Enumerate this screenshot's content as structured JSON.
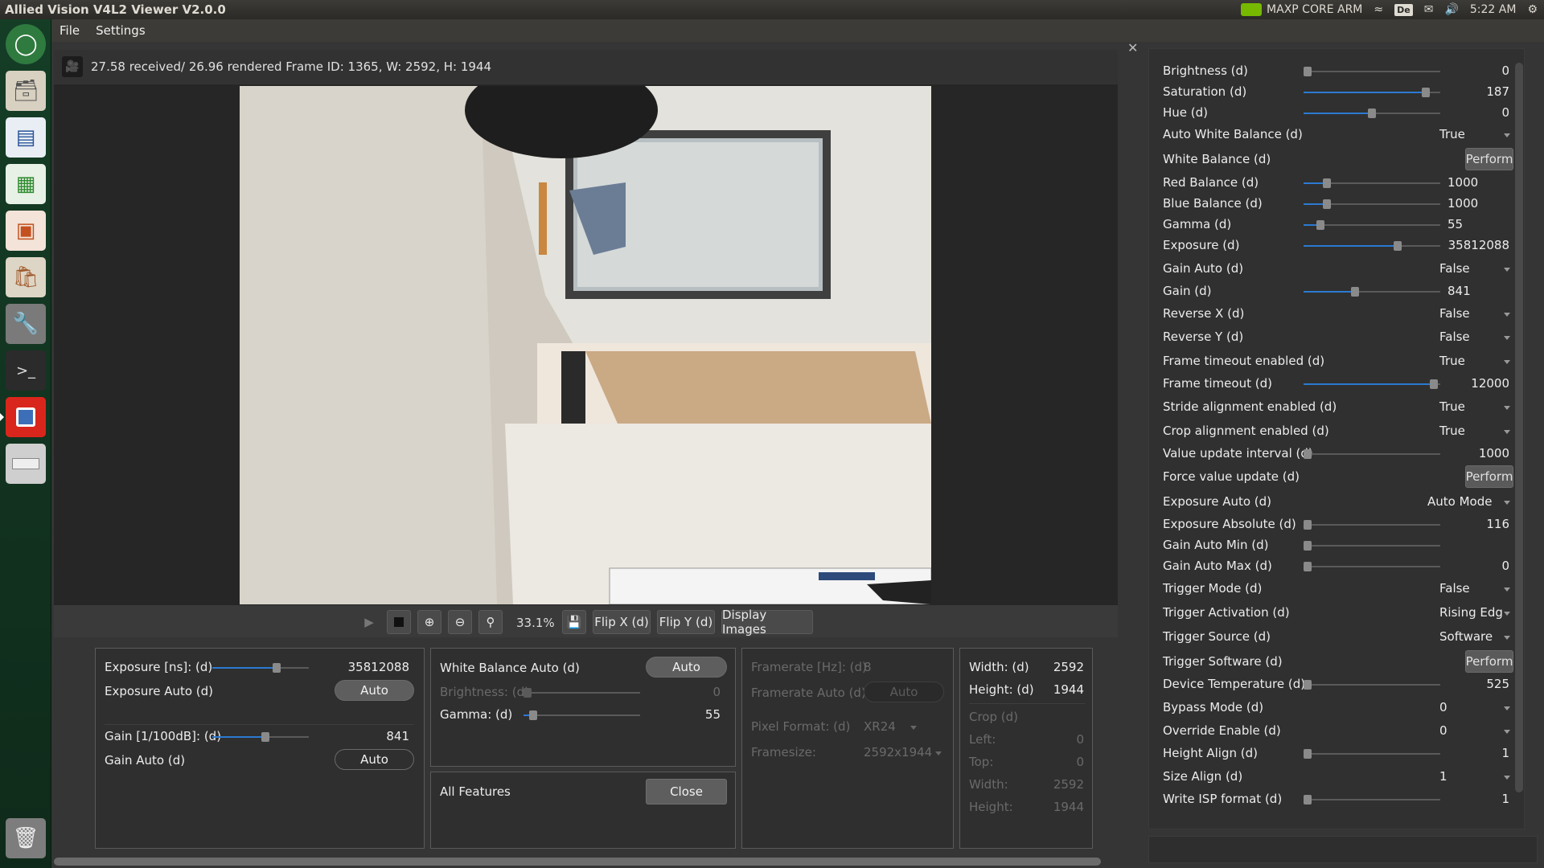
{
  "topbar": {
    "title": "Allied Vision V4L2 Viewer V2.0.0",
    "network_name": "MAXP CORE ARM",
    "keyboard_layout": "De",
    "time": "5:22 AM"
  },
  "menu": {
    "file": "File",
    "settings": "Settings"
  },
  "status": {
    "text": "27.58 received/ 26.96 rendered  Frame ID: 1365, W: 2592, H: 1944"
  },
  "toolbar": {
    "zoom": "33.1%",
    "flip_x": "Flip X (d)",
    "flip_y": "Flip Y (d)",
    "display_images": "Display Images"
  },
  "panel1": {
    "exposure_label": "Exposure [ns]: (d)",
    "exposure_value": "35812088",
    "exposure_level": 0.68,
    "exposure_auto_label": "Exposure Auto (d)",
    "exposure_auto_btn": "Auto",
    "gain_label": "Gain [1/100dB]: (d)",
    "gain_value": "841",
    "gain_level": 0.55,
    "gain_auto_label": "Gain Auto (d)",
    "gain_auto_btn": "Auto"
  },
  "panel2": {
    "wb_auto_label": "White Balance Auto (d)",
    "wb_auto_btn": "Auto",
    "brightness_label": "Brightness: (d)",
    "brightness_value": "0",
    "brightness_level": 0.0,
    "gamma_label": "Gamma: (d)",
    "gamma_value": "55",
    "gamma_level": 0.05,
    "all_features_label": "All Features",
    "close_btn": "Close"
  },
  "panel3": {
    "framerate_label": "Framerate [Hz]: (d)",
    "framerate_value": "8",
    "framerate_auto_label": "Framerate Auto (d)",
    "framerate_auto_btn": "Auto",
    "pixel_format_label": "Pixel Format: (d)",
    "pixel_format_value": "XR24",
    "framesize_label": "Framesize:",
    "framesize_value": "2592x1944"
  },
  "panel4": {
    "width_label": "Width: (d)",
    "width_value": "2592",
    "height_label": "Height: (d)",
    "height_value": "1944",
    "crop_label": "Crop (d)",
    "left_label": "Left:",
    "left_value": "0",
    "top_label": "Top:",
    "top_value": "0",
    "crop_width_label": "Width:",
    "crop_width_value": "2592",
    "crop_height_label": "Height:",
    "crop_height_value": "1944"
  },
  "features": [
    {
      "label": "Brightness (d)",
      "kind": "slider",
      "value": "0",
      "level": 0.0
    },
    {
      "label": "Saturation (d)",
      "kind": "slider",
      "value": "187",
      "level": 0.92
    },
    {
      "label": "Hue (d)",
      "kind": "slider",
      "value": "0",
      "level": 0.5
    },
    {
      "label": "Auto White Balance (d)",
      "kind": "combo",
      "value": "True"
    },
    {
      "label": "White Balance (d)",
      "kind": "button",
      "value": "Perform"
    },
    {
      "label": "Red Balance (d)",
      "kind": "slider",
      "value": "1000",
      "level": 0.15
    },
    {
      "label": "Blue Balance (d)",
      "kind": "slider",
      "value": "1000",
      "level": 0.15
    },
    {
      "label": "Gamma (d)",
      "kind": "slider",
      "value": "55",
      "level": 0.1
    },
    {
      "label": "Exposure (d)",
      "kind": "slider",
      "value": "35812088",
      "level": 0.7
    },
    {
      "label": "Gain Auto (d)",
      "kind": "combo",
      "value": "False"
    },
    {
      "label": "Gain (d)",
      "kind": "slider",
      "value": "841",
      "level": 0.37
    },
    {
      "label": "Reverse X (d)",
      "kind": "combo",
      "value": "False"
    },
    {
      "label": "Reverse Y (d)",
      "kind": "combo",
      "value": "False"
    },
    {
      "label": "Frame timeout enabled (d)",
      "kind": "combo",
      "value": "True"
    },
    {
      "label": "Frame timeout (d)",
      "kind": "slider",
      "value": "12000",
      "level": 0.98
    },
    {
      "label": "Stride alignment enabled (d)",
      "kind": "combo",
      "value": "True"
    },
    {
      "label": "Crop alignment enabled (d)",
      "kind": "combo",
      "value": "True"
    },
    {
      "label": "Value update interval (d)",
      "kind": "slider",
      "value": "1000",
      "level": 0.0
    },
    {
      "label": "Force value update (d)",
      "kind": "button",
      "value": "Perform"
    },
    {
      "label": "Exposure Auto (d)",
      "kind": "combo",
      "value": "Auto Mode"
    },
    {
      "label": "Exposure Absolute (d)",
      "kind": "slider",
      "value": "116",
      "level": 0.0
    },
    {
      "label": "Gain Auto Min (d)",
      "kind": "slider",
      "value": "",
      "level": 0.0
    },
    {
      "label": "Gain Auto Max (d)",
      "kind": "slider",
      "value": "0",
      "level": 0.0
    },
    {
      "label": "Trigger Mode (d)",
      "kind": "combo",
      "value": "False"
    },
    {
      "label": "Trigger Activation (d)",
      "kind": "combo",
      "value": "Rising Edg"
    },
    {
      "label": "Trigger Source (d)",
      "kind": "combo",
      "value": "Software"
    },
    {
      "label": "Trigger Software (d)",
      "kind": "button",
      "value": "Perform"
    },
    {
      "label": "Device Temperature (d)",
      "kind": "slider",
      "value": "525",
      "level": 0.0
    },
    {
      "label": "Bypass Mode (d)",
      "kind": "combo",
      "value": "0"
    },
    {
      "label": "Override Enable (d)",
      "kind": "combo",
      "value": "0"
    },
    {
      "label": "Height Align (d)",
      "kind": "slider",
      "value": "1",
      "level": 0.0
    },
    {
      "label": "Size Align (d)",
      "kind": "combo",
      "value": "1"
    },
    {
      "label": "Write ISP format (d)",
      "kind": "slider",
      "value": "1",
      "level": 0.0
    }
  ],
  "colors": {
    "accent": "#2b7ad1",
    "launcher_bg": "#153d26",
    "panel_bg": "#2f2f2f",
    "nvidia_green": "#76b900"
  }
}
